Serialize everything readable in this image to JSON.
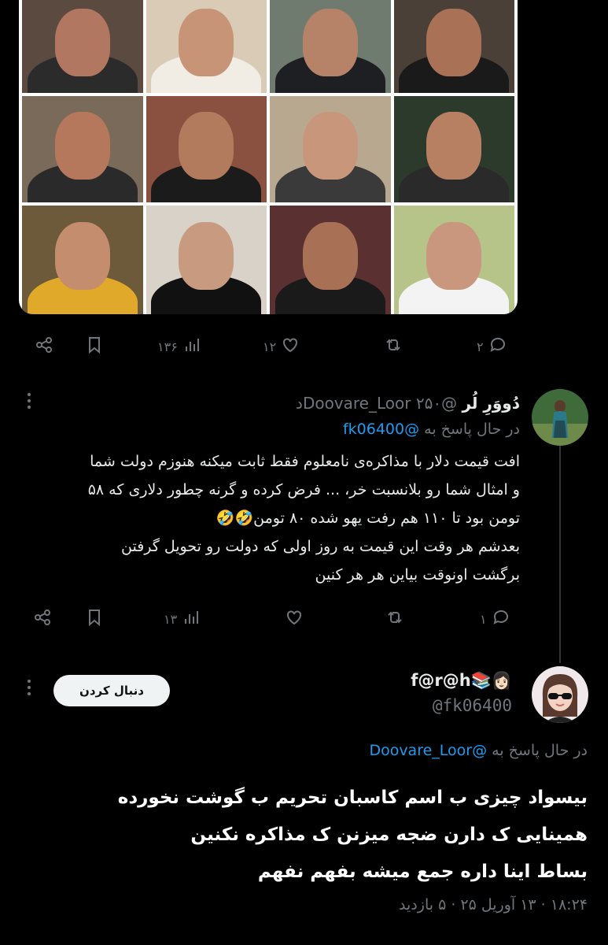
{
  "image_grid": {
    "tiles": [
      {
        "bg": "#5a4a3f",
        "skin": "#b27760",
        "cloth": "#2b2b2b"
      },
      {
        "bg": "#d9cbb6",
        "skin": "#c79478",
        "cloth": "#f1ece4"
      },
      {
        "bg": "#6f7b6e",
        "skin": "#b78368",
        "cloth": "#1e1f22"
      },
      {
        "bg": "#4a4038",
        "skin": "#a97256",
        "cloth": "#1a1a1a"
      },
      {
        "bg": "#7a6a5a",
        "skin": "#b6785c",
        "cloth": "#2a2a2a"
      },
      {
        "bg": "#8a5040",
        "skin": "#b27b5d",
        "cloth": "#1b1b1b"
      },
      {
        "bg": "#b9a890",
        "skin": "#c8977b",
        "cloth": "#3a3a3a"
      },
      {
        "bg": "#2c3a2c",
        "skin": "#b88063",
        "cloth": "#2a2a2a"
      },
      {
        "bg": "#6c5a3a",
        "skin": "#c48d6d",
        "cloth": "#e0a92a"
      },
      {
        "bg": "#d8d2c8",
        "skin": "#c89b80",
        "cloth": "#111111"
      },
      {
        "bg": "#5a3030",
        "skin": "#a87055",
        "cloth": "#1a1a1a"
      },
      {
        "bg": "#b6c48a",
        "skin": "#c9977d",
        "cloth": "#f3f3f3"
      }
    ]
  },
  "post1_actions": {
    "reply_count": "۲",
    "retweet_count": "",
    "like_count": "۱۲",
    "views_count": "۱۳۶"
  },
  "reply1": {
    "display_name": "دُووَرِ لُر",
    "handle": "@Doovare_Loor",
    "time": "۲۵۰د",
    "replying_to_prefix": "در حال پاسخ به",
    "replying_to": "@fk06400",
    "text_lines": [
      "افت قیمت دلار با مذاکره‌ی نامعلوم فقط ثابت میکنه هنوزم دولت شما",
      "و امثال شما رو بلانسبت خر، ... فرض کرده و گرنه چطور دلاری که ۵۸",
      "تومن بود تا ۱۱۰ هم رفت یهو شده ۸۰ تومن🤣🤣",
      "بعدشم هر وقت این قیمت به روز اولی که دولت رو تحویل گرفتن",
      "برگشت اونوقت بیاین هر هر کنین"
    ],
    "reply_count": "۱",
    "retweet_count": "",
    "like_count": "",
    "views_count": "۱۳",
    "avatar_colors": {
      "bg": "#3f6a3a",
      "fig": "#2a7a8a"
    }
  },
  "main_tweet": {
    "display_name": "f@r@h📚👩🏻",
    "handle": "@fk06400",
    "follow_label": "دنبال کردن",
    "replying_to_prefix": "در حال پاسخ به",
    "replying_to": "@Doovare_Loor",
    "text_lines": [
      "بیسواد چیزی ب اسم کاسبان تحریم  ب گوشت نخورده",
      "همینایی ک دارن ضجه میزنن ک مذاکره نکنین",
      "بساط اینا داره جمع میشه بفهم نفهم"
    ],
    "meta": "۱۸:۲۴ · ۱۳ آوریل ۲۵ · ۵ بازدید"
  },
  "colors": {
    "link": "#1d9bf0",
    "muted": "#71767b",
    "text": "#e7e9ea",
    "line": "#333639"
  },
  "icons": [
    "share-icon",
    "bookmark-icon",
    "views-icon",
    "like-icon",
    "retweet-icon",
    "reply-icon",
    "more-icon"
  ]
}
